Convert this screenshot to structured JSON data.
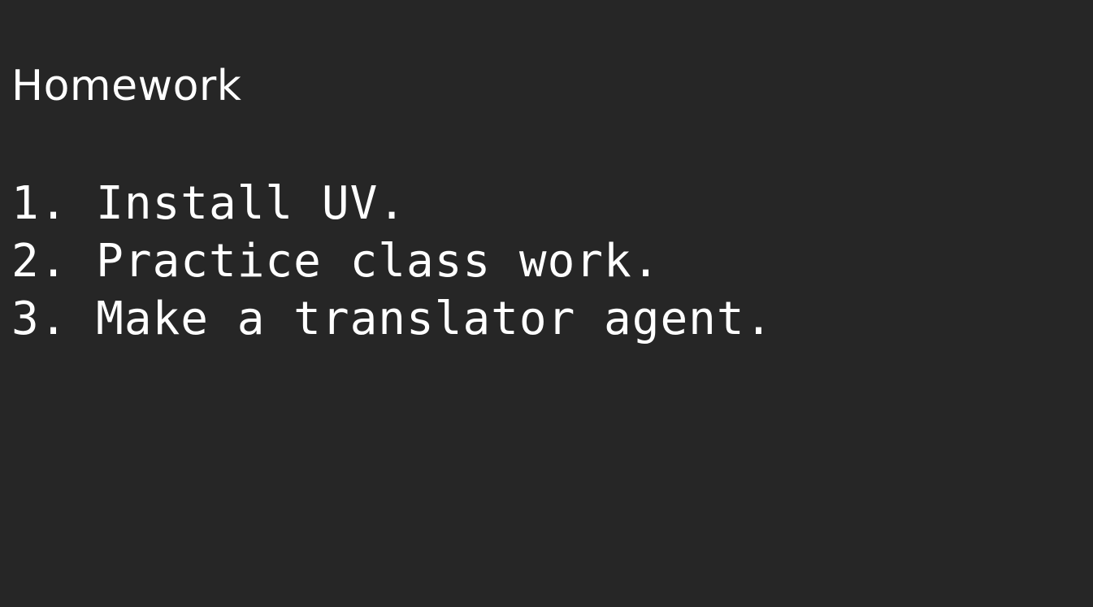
{
  "document": {
    "title": "Homework",
    "items": [
      "1. Install UV.",
      "2. Practice class work.",
      "3. Make a translator agent."
    ]
  },
  "colors": {
    "background": "#262626",
    "text": "#ffffff"
  }
}
